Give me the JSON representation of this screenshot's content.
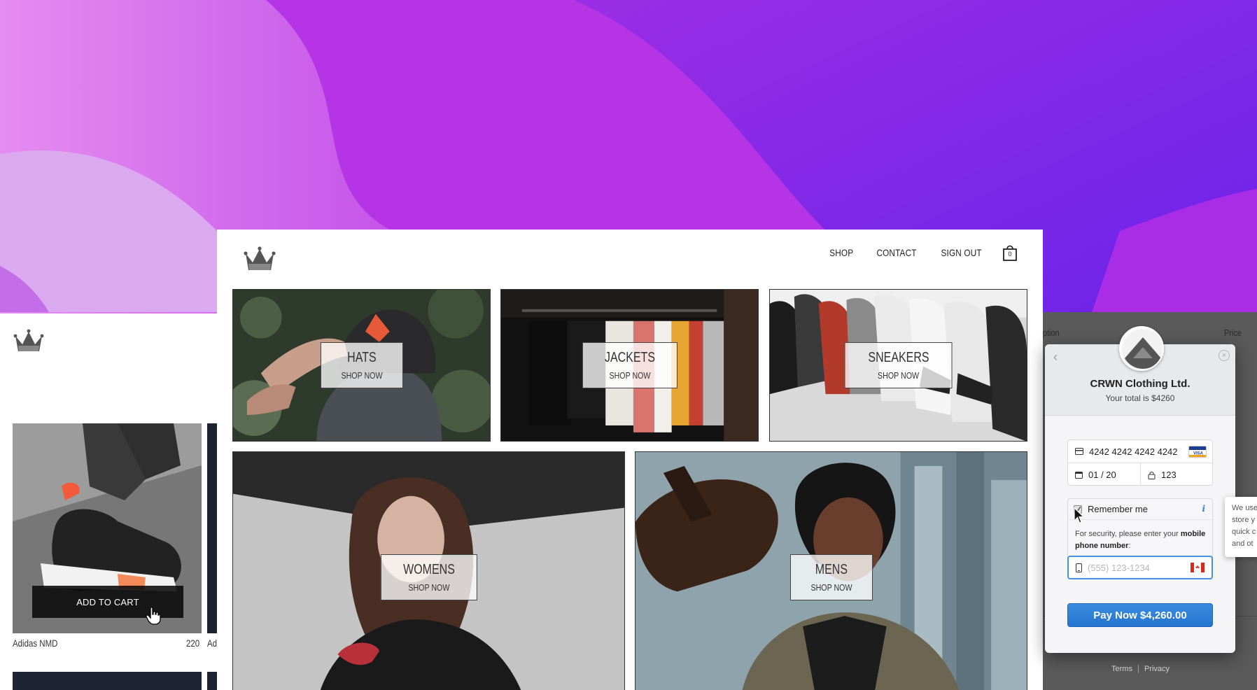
{
  "colors": {
    "accent": "#2574cf",
    "focus_border": "#4a90e2",
    "background_purple": "#9a2de0"
  },
  "main": {
    "nav": {
      "shop": "SHOP",
      "contact": "CONTACT",
      "sign_out": "SIGN OUT",
      "cart_count": "0"
    },
    "categories": [
      {
        "title": "HATS",
        "subtitle": "SHOP NOW"
      },
      {
        "title": "JACKETS",
        "subtitle": "SHOP NOW"
      },
      {
        "title": "SNEAKERS",
        "subtitle": "SHOP NOW"
      },
      {
        "title": "WOMENS",
        "subtitle": "SHOP NOW"
      },
      {
        "title": "MENS",
        "subtitle": "SHOP NOW"
      }
    ]
  },
  "left_panel": {
    "add_to_cart": "ADD TO CART",
    "product_name": "Adidas NMD",
    "product_price": "220",
    "next_product_partial": "Ad"
  },
  "checkout_table": {
    "header_option": "ption",
    "header_price": "Price"
  },
  "stripe": {
    "merchant": "CRWN Clothing Ltd.",
    "total": "Your total is $4260",
    "card_number": "4242 4242 4242 4242",
    "expiry": "01 / 20",
    "cvc": "123",
    "remember_label": "Remember me",
    "security_prefix": "For security, please enter your",
    "security_bold": "mobile phone number",
    "security_suffix": ":",
    "phone_placeholder": "(555) 123-1234",
    "pay_button": "Pay Now $4,260.00",
    "footer_terms": "Terms",
    "footer_privacy": "Privacy"
  },
  "tooltip": {
    "lines": [
      "We use",
      "store y",
      "quick c",
      "and ot"
    ]
  }
}
